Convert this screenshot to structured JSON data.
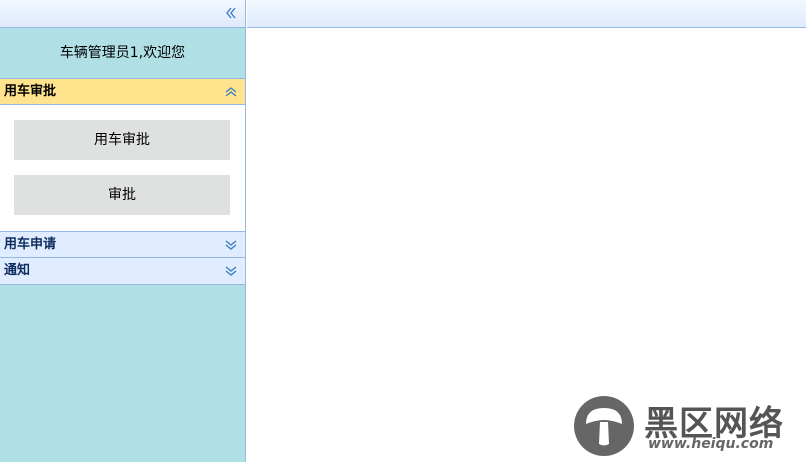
{
  "sidebar": {
    "collapse_icon": "double-chevron-left-icon",
    "welcome": "车辆管理员1,欢迎您",
    "panels": [
      {
        "title": "用车审批",
        "expanded": true,
        "tool_icon": "double-chevron-up-icon",
        "items": [
          "用车审批",
          "审批"
        ]
      },
      {
        "title": "用车申请",
        "expanded": false,
        "tool_icon": "double-chevron-down-icon"
      },
      {
        "title": "通知",
        "expanded": false,
        "tool_icon": "double-chevron-down-icon"
      }
    ]
  },
  "watermark": {
    "title": "黑区网络",
    "url": "www.heiqu.com"
  },
  "colors": {
    "sidebar_bg": "#b0e0e6",
    "active_header": "#ffe48d",
    "inactive_header": "#e0ecff",
    "border": "#95b8e7",
    "menu_button": "#dfe1e0"
  }
}
